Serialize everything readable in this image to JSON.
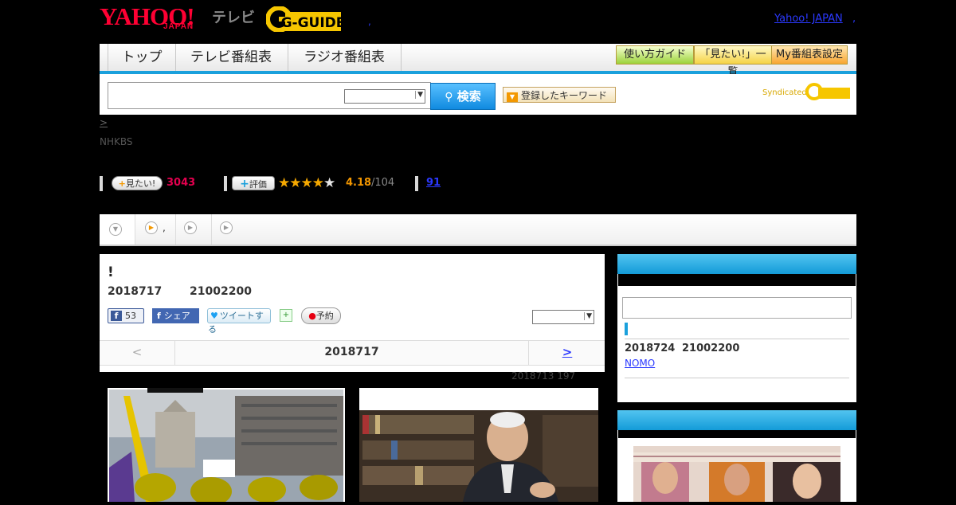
{
  "header": {
    "logo_text": "YAHOO!",
    "logo_sub": "JAPAN",
    "logo_tv": "テレビ",
    "gguide_logo": "G-GUIDE",
    "yahoo_japan_link": "Yahoo! JAPAN",
    "sep_link": ",",
    "dot": ","
  },
  "nav": {
    "tabs": [
      {
        "label": "トップ"
      },
      {
        "label": "テレビ番組表"
      },
      {
        "label": "ラジオ番組表"
      }
    ],
    "right_buttons": [
      {
        "label": "使い方ガイド"
      },
      {
        "label": "「見たい!」一覧"
      },
      {
        "label": "My番組表設定"
      }
    ]
  },
  "search": {
    "input_value": "",
    "select_value": "",
    "button_label": "検索",
    "keyword_button": "登録したキーワード",
    "syndicated": "Syndicated"
  },
  "breadcrumb": ">",
  "channel": "NHKBS",
  "stats": {
    "want_label": "見たい!",
    "want_count": "3043",
    "rating_label": "評価",
    "rating_value": 4.18,
    "rating_value_text": "4.18",
    "rating_total": "/104",
    "rating_stars": 4,
    "comment_count": "91"
  },
  "subnav": {
    "items": [
      {
        "label": ""
      },
      {
        "label": ","
      },
      {
        "label": ""
      },
      {
        "label": ""
      }
    ]
  },
  "program": {
    "title": "!",
    "date": "2018717",
    "time": "21002200",
    "like_count": "53",
    "share_label": "シェア",
    "tweet_label": "ツイートする",
    "reserve_label": "予約",
    "select_value": "",
    "prev_label": "<",
    "current_date": "2018717",
    "next_label": ">",
    "updated": "2018713 197"
  },
  "sidebar": {
    "search_value": "",
    "next_date": "2018724",
    "next_time": "21002200",
    "next_link": "NOMO"
  },
  "colors": {
    "accent": "#1aa0dc",
    "want": "#e4004f",
    "rating": "#f29600",
    "link": "#2b39ff"
  }
}
